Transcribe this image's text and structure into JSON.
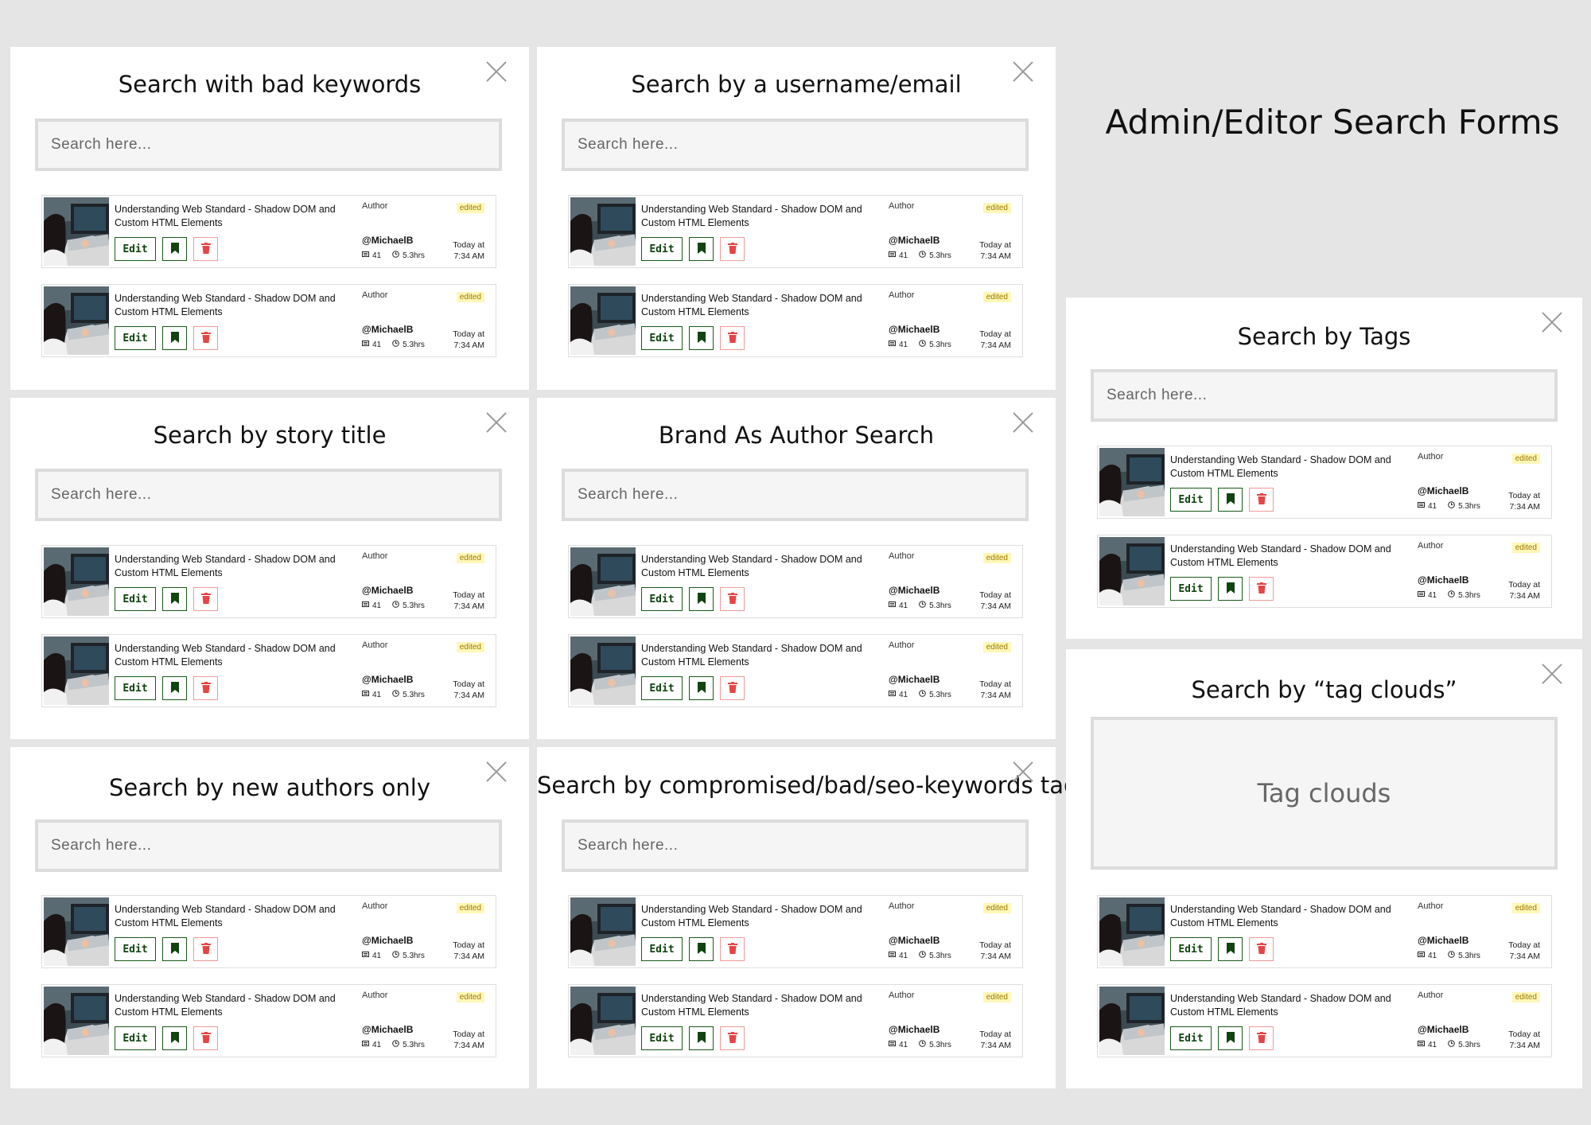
{
  "page_title": "Admin/Editor Search Forms",
  "search_placeholder": "Search here...",
  "story": {
    "title": "Understanding Web Standard - Shadow DOM and Custom HTML Elements",
    "author_label": "Author",
    "badge": "edited",
    "handle": "@MichaelB",
    "comments": "41",
    "read_time": "5.3hrs",
    "time_line1": "Today at",
    "time_line2": "7:34 AM",
    "edit_label": "Edit"
  },
  "panels": [
    {
      "id": "bad-keywords",
      "title": "Search with bad keywords"
    },
    {
      "id": "username-email",
      "title": "Search by a username/email"
    },
    {
      "id": "story-title",
      "title": "Search by story title"
    },
    {
      "id": "brand-author",
      "title": "Brand As Author Search"
    },
    {
      "id": "new-authors",
      "title": "Search by new authors only"
    },
    {
      "id": "compromised-tags",
      "title": "Search by compromised/bad/seo-keywords tags"
    },
    {
      "id": "tags",
      "title": "Search by Tags"
    },
    {
      "id": "tag-clouds",
      "title": "Search by “tag clouds”",
      "cloud_text": "Tag clouds"
    }
  ],
  "colors": {
    "background": "#e5e5e5",
    "edit_border": "#1a5a1a",
    "delete_red": "#e64545",
    "badge_bg": "#fff7b8"
  },
  "icons": [
    "close-icon",
    "bookmark-icon",
    "trash-icon",
    "comment-icon",
    "clock-icon"
  ]
}
